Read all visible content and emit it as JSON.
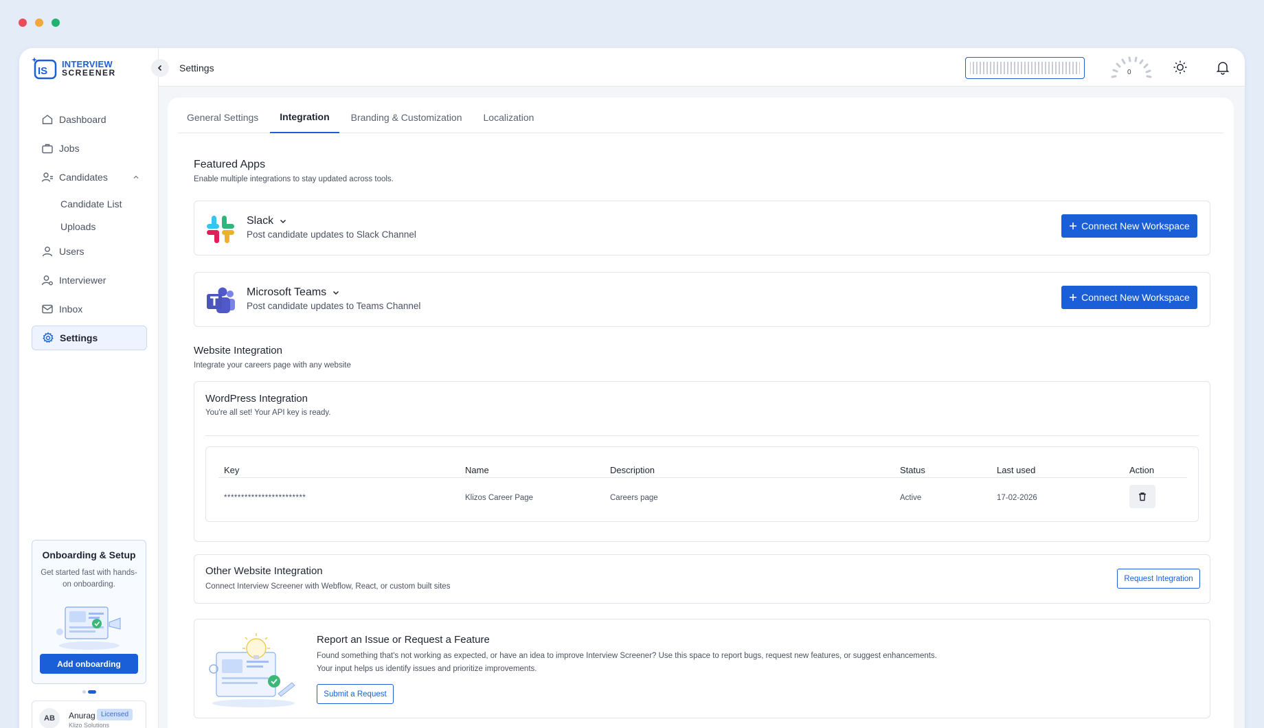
{
  "colors": {
    "accent": "#1a5fd8",
    "dot_red": "#ee4b5a",
    "dot_yellow": "#f2a93b",
    "dot_green": "#23b26d"
  },
  "logo": {
    "line1": "INTERVIEW",
    "line2": "SCREENER",
    "mark": "IS"
  },
  "sidebar": {
    "items": [
      {
        "label": "Dashboard",
        "icon": "home-icon"
      },
      {
        "label": "Jobs",
        "icon": "briefcase-icon"
      },
      {
        "label": "Candidates",
        "icon": "candidates-icon",
        "expanded": true
      },
      {
        "label": "Users",
        "icon": "user-icon"
      },
      {
        "label": "Interviewer",
        "icon": "interviewer-icon"
      },
      {
        "label": "Inbox",
        "icon": "inbox-icon"
      },
      {
        "label": "Settings",
        "icon": "gear-icon",
        "active": true
      }
    ],
    "candidates_sub": [
      "Candidate List",
      "Uploads"
    ],
    "onboarding": {
      "title": "Onboarding & Setup",
      "subtitle": "Get started fast with hands-on onboarding.",
      "button": "Add onboarding"
    },
    "user": {
      "initials": "AB",
      "name": "Anurag",
      "badge": "Licensed",
      "company": "Klizo Solutions"
    }
  },
  "topbar": {
    "title": "Settings",
    "gauge_value": "0"
  },
  "tabs": [
    "General Settings",
    "Integration",
    "Branding & Customization",
    "Localization"
  ],
  "featured": {
    "title": "Featured Apps",
    "subtitle": "Enable multiple integrations to stay updated across tools.",
    "apps": [
      {
        "name": "Slack",
        "desc": "Post candidate updates to Slack Channel",
        "button": "Connect New Workspace",
        "icon": "slack-icon"
      },
      {
        "name": "Microsoft Teams",
        "desc": "Post candidate updates to Teams Channel",
        "button": "Connect New Workspace",
        "icon": "teams-icon"
      }
    ]
  },
  "website": {
    "title": "Website Integration",
    "subtitle": "Integrate your careers page with any website",
    "wordpress": {
      "title": "WordPress Integration",
      "subtitle": "You're all set! Your API key is ready.",
      "columns": [
        "Key",
        "Name",
        "Description",
        "Status",
        "Last used",
        "Action"
      ],
      "row": {
        "key": "************************",
        "name": "Klizos Career Page",
        "description": "Careers page",
        "status": "Active",
        "last_used": "17-02-2026"
      }
    },
    "other": {
      "title": "Other Website Integration",
      "subtitle": "Connect Interview Screener with Webflow, React, or custom built sites",
      "button": "Request Integration"
    }
  },
  "report": {
    "title": "Report an Issue or Request a Feature",
    "line1": "Found something that's not working as expected, or have an idea to improve Interview Screener? Use this space to report bugs, request new features, or suggest enhancements.",
    "line2": "Your input helps us identify issues and prioritize improvements.",
    "button": "Submit a Request"
  }
}
